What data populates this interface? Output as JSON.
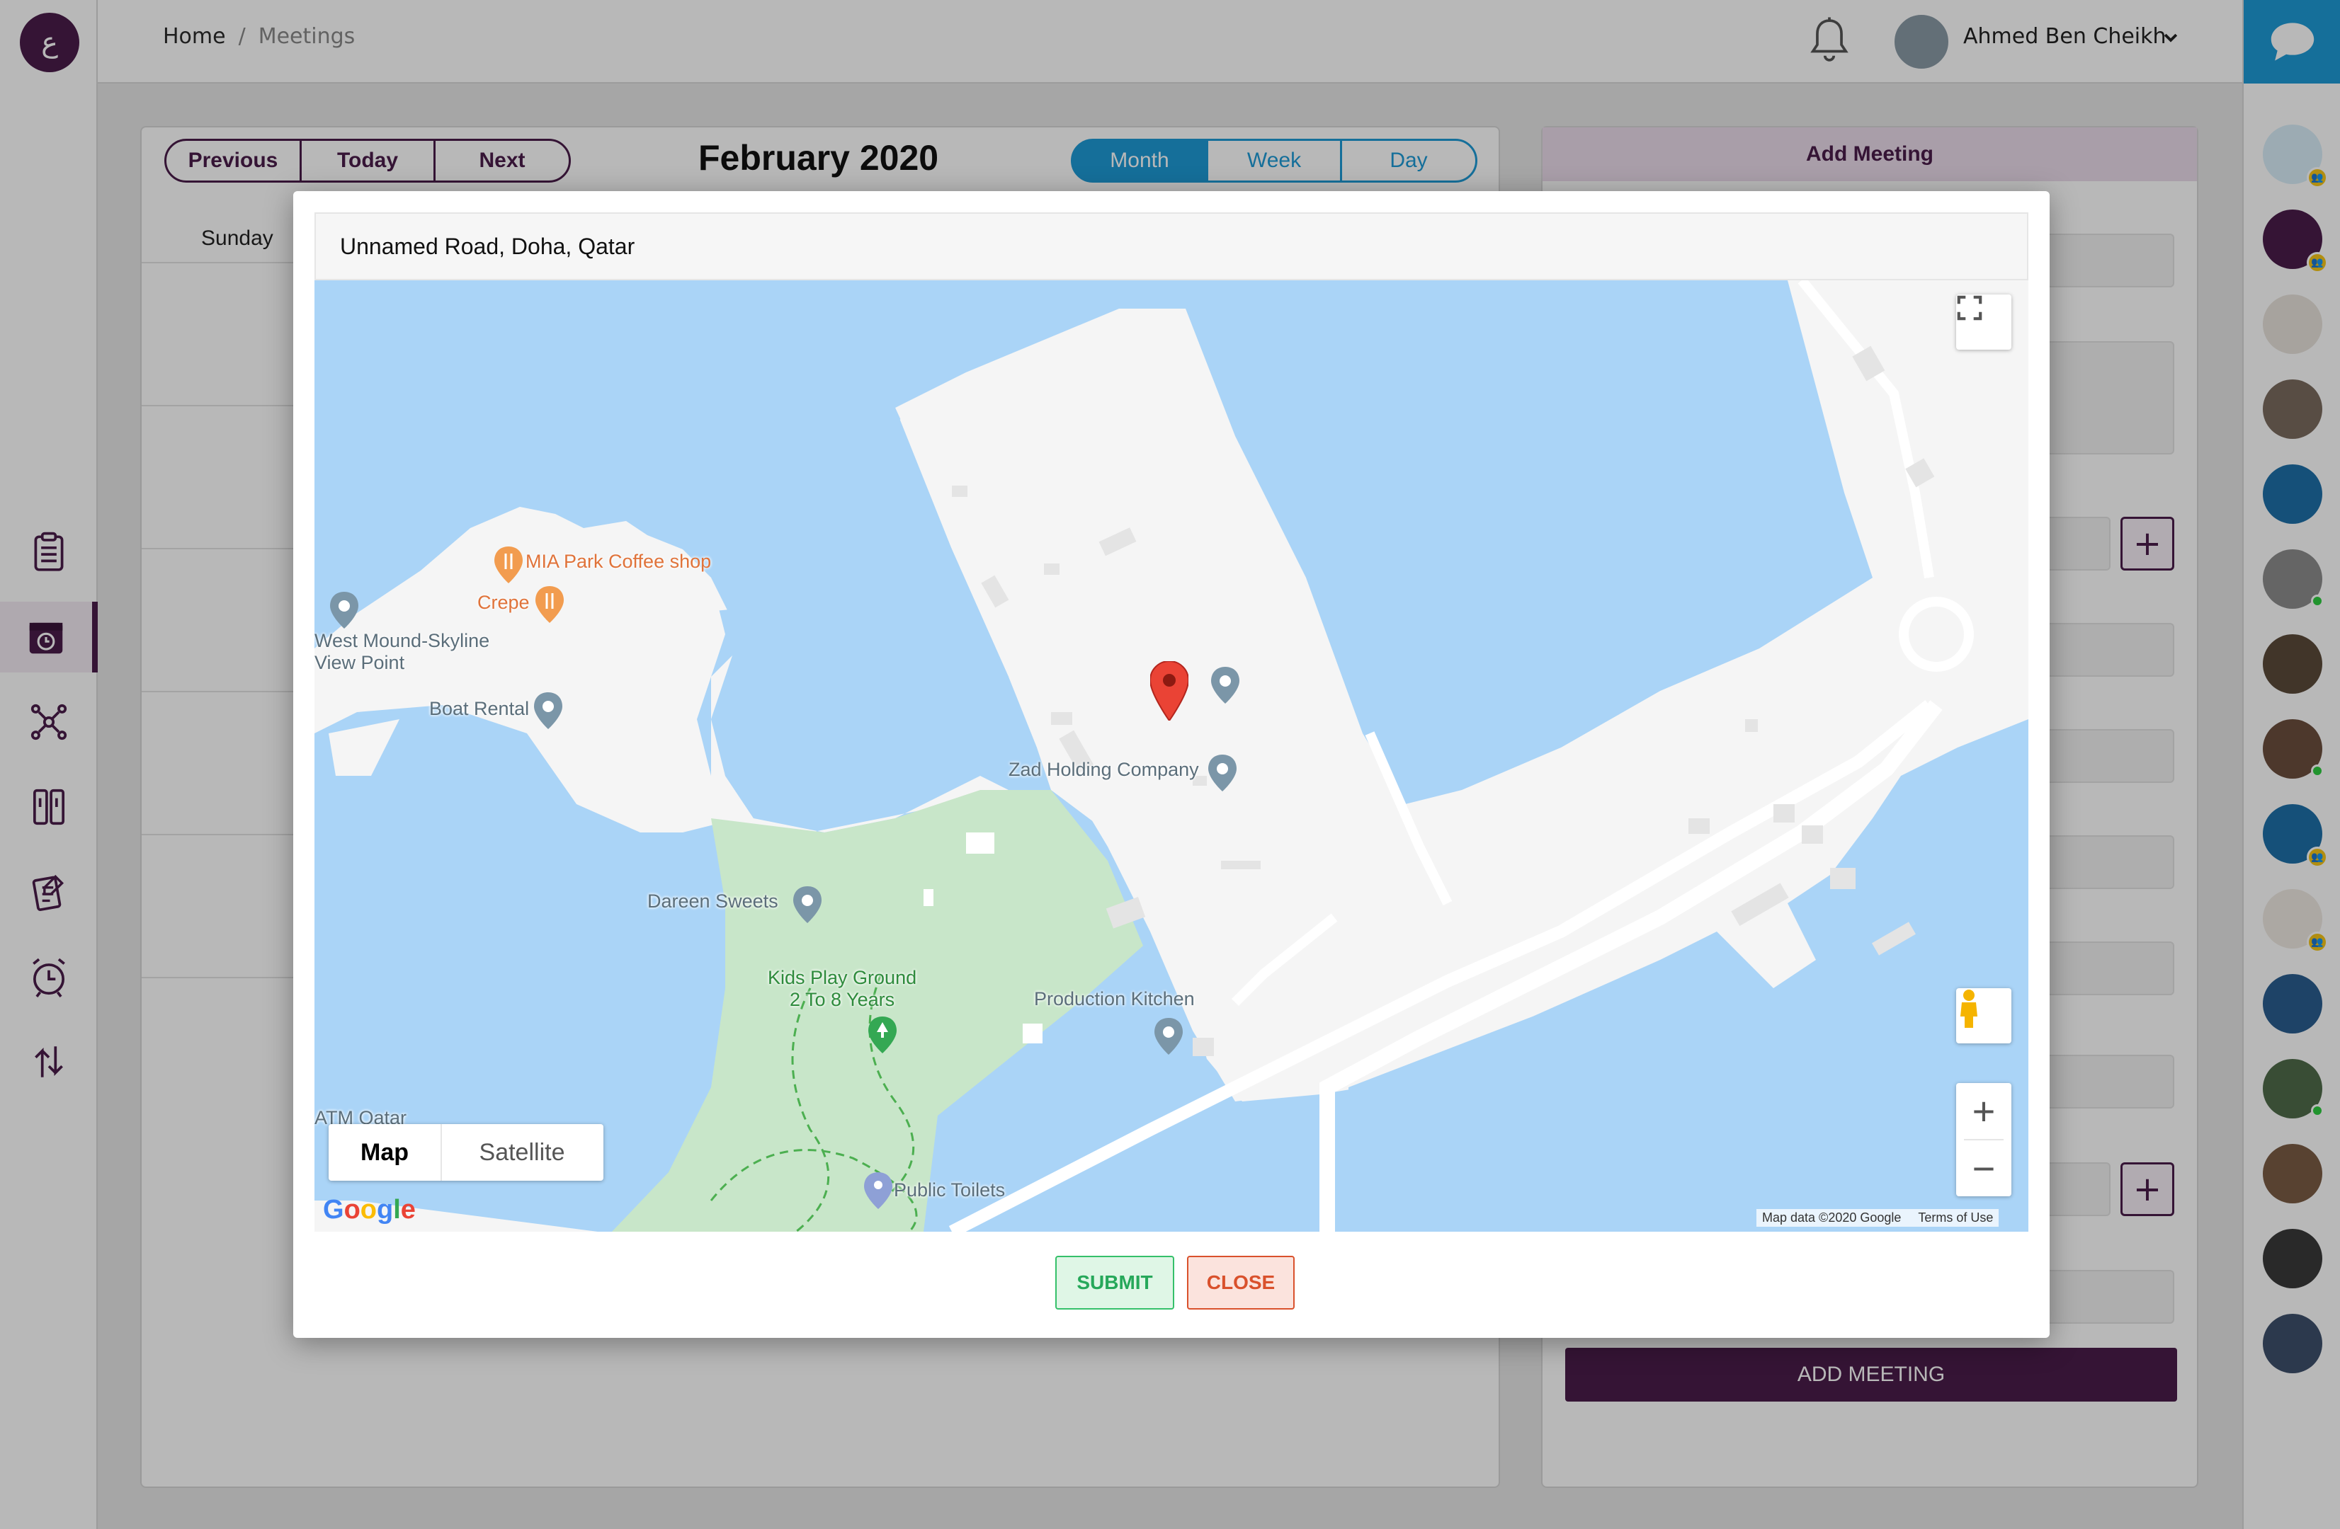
{
  "breadcrumb": {
    "home": "Home",
    "separator": "/",
    "current": "Meetings"
  },
  "user": {
    "name": "Ahmed Ben Cheikh"
  },
  "calendar": {
    "nav": {
      "previous": "Previous",
      "today": "Today",
      "next": "Next"
    },
    "title": "February 2020",
    "views": {
      "month": "Month",
      "week": "Week",
      "day": "Day"
    },
    "day_headers": [
      "Sunday"
    ]
  },
  "add_meeting": {
    "header": "Add Meeting",
    "button": "ADD MEETING"
  },
  "modal": {
    "address": "Unnamed Road, Doha, Qatar",
    "map": {
      "type_map": "Map",
      "type_satellite": "Satellite",
      "zoom_in": "+",
      "zoom_out": "−",
      "attribution": "Map data ©2020 Google",
      "terms": "Terms of Use",
      "google": "Google",
      "pois": {
        "mia_coffee": "MIA Park Coffee shop",
        "crepe": "Crepe",
        "west_mound_1": "West Mound-Skyline",
        "west_mound_2": "View Point",
        "boat_rental": "Boat Rental",
        "zad_holding": "Zad Holding Company",
        "dareen": "Dareen Sweets",
        "kids_play_1": "Kids Play Ground",
        "kids_play_2": "2 To 8 Years",
        "production_kitchen": "Production Kitchen",
        "public_toilets": "Public Toilets",
        "atm_qatar": "ATM Qatar"
      }
    },
    "submit": "SUBMIT",
    "close": "CLOSE"
  },
  "colors": {
    "brand": "#4a1d4a",
    "accent_blue": "#1e9ad6",
    "water": "#aad4f7",
    "park": "#c8e6c9",
    "marker_red": "#ea4335"
  }
}
